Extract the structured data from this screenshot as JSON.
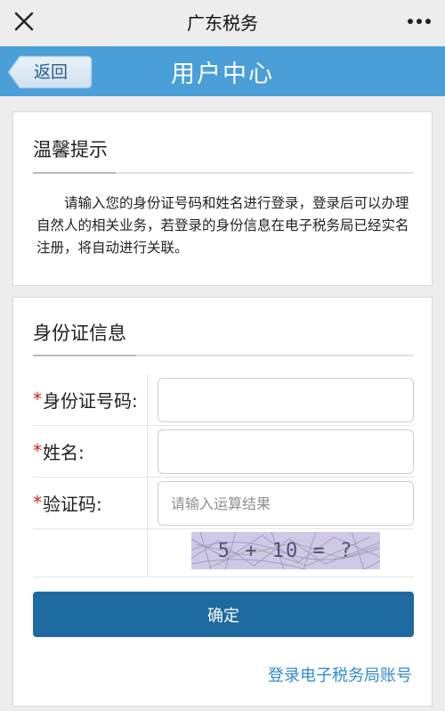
{
  "appbar": {
    "title": "广东税务",
    "close_icon": "close-icon",
    "more_icon": "more-dots-icon"
  },
  "header": {
    "title": "用户中心",
    "back_label": "返回",
    "color": "#4a9fd8"
  },
  "notice_card": {
    "title": "温馨提示",
    "text": "请输入您的身份证号码和姓名进行登录，登录后可以办理自然人的相关业务，若登录的身份信息在电子税务局已经实名注册，将自动进行关联。"
  },
  "form": {
    "title": "身份证信息",
    "required_mark": "*",
    "fields": [
      {
        "label": "身份证号码:",
        "value": "",
        "placeholder": ""
      },
      {
        "label": "姓名:",
        "value": "",
        "placeholder": ""
      },
      {
        "label": "验证码:",
        "value": "",
        "placeholder": "请输入运算结果"
      }
    ],
    "captcha_text": "5 + 10 = ?",
    "submit_label": "确定",
    "submit_color": "#1e6aa0",
    "link_label": "登录电子税务局账号",
    "link_color": "#2e8ccf"
  }
}
